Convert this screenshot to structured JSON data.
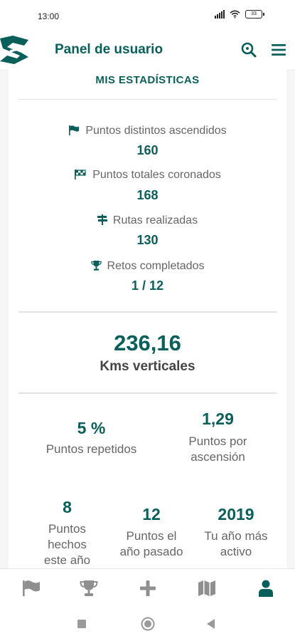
{
  "status_bar": {
    "time": "13:00",
    "battery": "33"
  },
  "app_bar": {
    "title": "Panel de usuario"
  },
  "stats": {
    "heading": "MIS ESTADÍSTICAS",
    "items": [
      {
        "label": "Puntos distintos ascendidos",
        "value": "160",
        "icon": "flag-icon"
      },
      {
        "label": "Puntos totales coronados",
        "value": "168",
        "icon": "checkered-flag-icon"
      },
      {
        "label": "Rutas realizadas",
        "value": "130",
        "icon": "signpost-icon"
      },
      {
        "label": "Retos completados",
        "value": "1 / 12",
        "icon": "trophy-icon"
      }
    ],
    "kms": {
      "value": "236,16",
      "label": "Kms verticales"
    },
    "metrics": [
      {
        "value": "5 %",
        "label_lines": [
          "Puntos repetidos"
        ]
      },
      {
        "value": "1,29",
        "label_lines": [
          "Puntos por",
          "ascensión"
        ]
      },
      {
        "value": "8",
        "label_lines": [
          "Puntos",
          "hechos",
          "este año"
        ]
      },
      {
        "value": "12",
        "label_lines": [
          "Puntos el",
          "año pasado"
        ]
      },
      {
        "value": "2019",
        "label_lines": [
          "Tu año más",
          "activo"
        ]
      }
    ]
  },
  "bottom_nav": [
    "flag-icon",
    "trophy-icon",
    "plus-icon",
    "map-icon",
    "user-icon"
  ],
  "colors": {
    "accent": "#0b5f5b",
    "nav_inactive": "#8f8f8f"
  }
}
